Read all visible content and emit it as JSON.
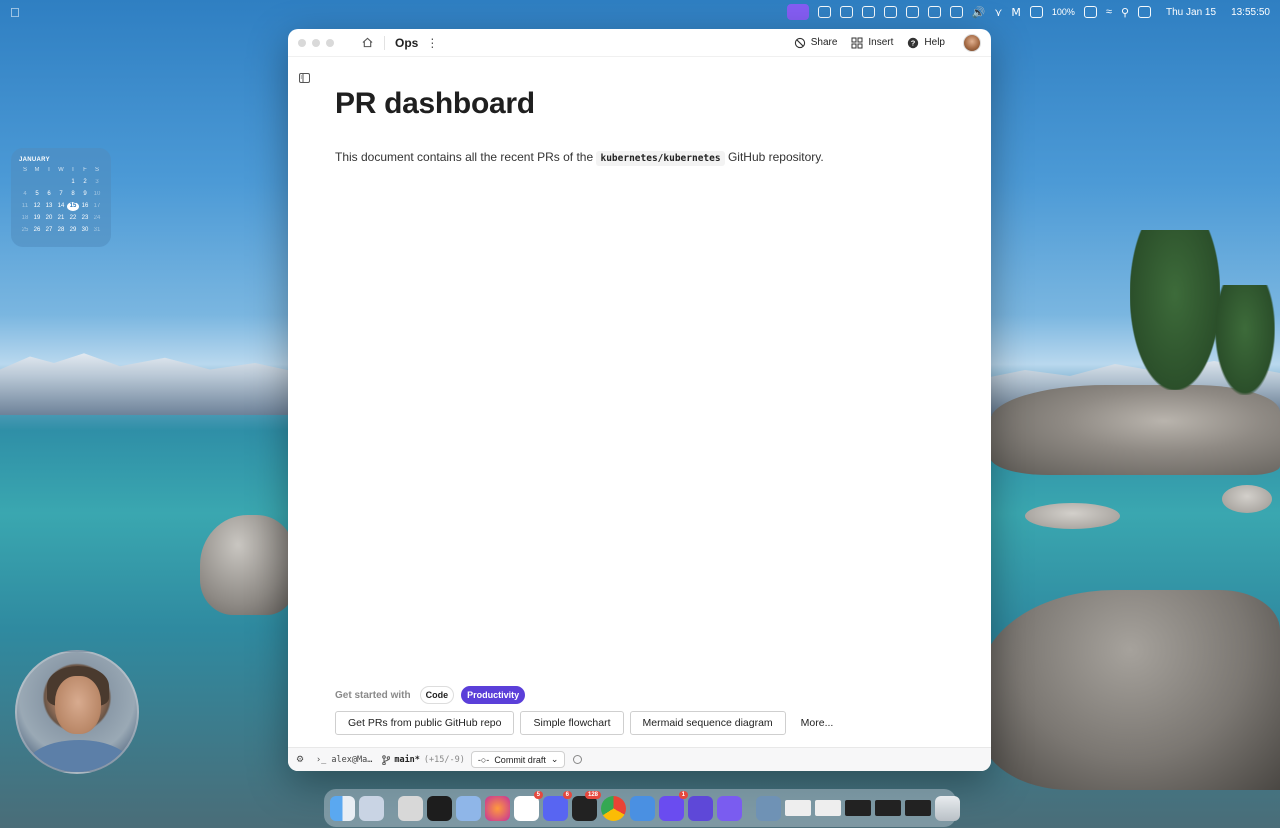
{
  "menubar": {
    "date": "Thu Jan 15",
    "time": "13:55:50",
    "battery": "100%"
  },
  "calendar": {
    "month": "JANUARY",
    "weekdays": [
      "S",
      "M",
      "T",
      "W",
      "T",
      "F",
      "S"
    ],
    "weeks": [
      [
        "",
        "",
        "",
        "",
        "1",
        "2",
        "3"
      ],
      [
        "4",
        "5",
        "6",
        "7",
        "8",
        "9",
        "10"
      ],
      [
        "11",
        "12",
        "13",
        "14",
        "15",
        "16",
        "17"
      ],
      [
        "18",
        "19",
        "20",
        "21",
        "22",
        "23",
        "24"
      ],
      [
        "25",
        "26",
        "27",
        "28",
        "29",
        "30",
        "31"
      ]
    ],
    "today": "15"
  },
  "window": {
    "doc_name": "Ops",
    "share_label": "Share",
    "insert_label": "Insert",
    "help_label": "Help"
  },
  "document": {
    "title": "PR dashboard",
    "body_before": "This document contains all the recent PRs of the",
    "body_code": "kubernetes/kubernetes",
    "body_after": "GitHub repository."
  },
  "get_started": {
    "label": "Get started with",
    "chips": [
      {
        "label": "Code",
        "active": false
      },
      {
        "label": "Productivity",
        "active": true
      }
    ],
    "suggestions": [
      "Get PRs from public GitHub repo",
      "Simple flowchart",
      "Mermaid sequence diagram"
    ],
    "more_label": "More..."
  },
  "statusbar": {
    "terminal": "alex@Ma…",
    "branch": "main*",
    "diff": "(+15/-9)",
    "commit_label": "Commit draft"
  },
  "dock": {
    "badges": {
      "slack": "5",
      "discord": "6",
      "linear": "128",
      "messenger": "1"
    }
  },
  "colors": {
    "accent": "#5b3fd9",
    "menubar_active": "#8a5cf6"
  }
}
